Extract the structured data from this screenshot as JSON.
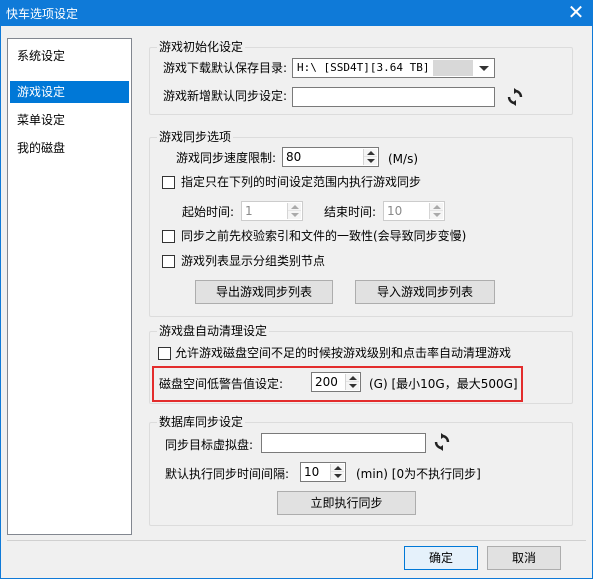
{
  "window": {
    "title": "快车选项设定"
  },
  "nav": {
    "items": [
      "系统设定",
      "游戏设定",
      "菜单设定",
      "我的磁盘"
    ],
    "selected": "游戏设定"
  },
  "init_group": {
    "title": "游戏初始化设定",
    "download_label": "游戏下载默认保存目录:",
    "download_value": "H:\\ [SSD4T][3.64 TB]",
    "sync_label": "游戏新增默认同步设定:",
    "sync_value": ""
  },
  "sync_group": {
    "title": "游戏同步选项",
    "speed_label": "游戏同步速度限制:",
    "speed_value": "80",
    "speed_unit": "(M/s)",
    "time_range_label": "指定只在下列的时间设定范围内执行游戏同步",
    "start_label": "起始时间:",
    "start_value": "1",
    "end_label": "结束时间:",
    "end_value": "10",
    "verify_label": "同步之前先校验索引和文件的一致性(会导致同步变慢)",
    "category_label": "游戏列表显示分组类别节点",
    "export_button": "导出游戏同步列表",
    "import_button": "导入游戏同步列表"
  },
  "clean_group": {
    "title": "游戏盘自动清理设定",
    "allow_label": "允许游戏磁盘空间不足的时候按游戏级别和点击率自动清理游戏",
    "warn_label": "磁盘空间低警告值设定:",
    "warn_value": "200",
    "warn_hint": "(G) [最小10G，最大500G]"
  },
  "db_group": {
    "title": "数据库同步设定",
    "target_label": "同步目标虚拟盘:",
    "target_value": "",
    "interval_label": "默认执行同步时间间隔:",
    "interval_value": "10",
    "interval_hint": "(min) [0为不执行同步]",
    "run_button": "立即执行同步"
  },
  "footer": {
    "ok_button": "确定",
    "cancel_button": "取消"
  },
  "colors": {
    "titlebar": "#0f7ad8",
    "selection": "#0078d7",
    "highlight": "#e32c2c"
  },
  "icons": {
    "close": "close-icon",
    "refresh": "refresh-icon",
    "dropdown": "chevron-down-icon"
  }
}
